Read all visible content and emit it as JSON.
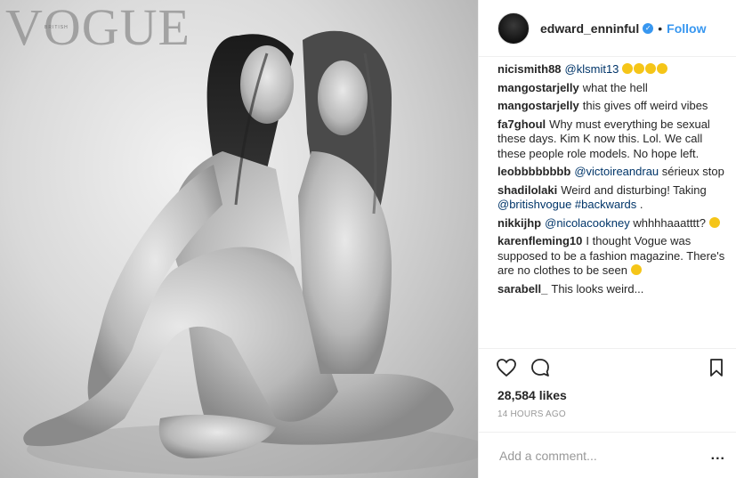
{
  "photo": {
    "masthead": "VOGUE",
    "masthead_sub": "BRITISH"
  },
  "header": {
    "username": "edward_enninful",
    "verified": true,
    "separator": "•",
    "follow_label": "Follow"
  },
  "comments": [
    {
      "user": "nicismith88",
      "parts": [
        {
          "t": "@klsmit13",
          "m": true
        },
        {
          "t": " ",
          "m": false
        }
      ],
      "emoji_count": 4
    },
    {
      "user": "mangostarjelly",
      "parts": [
        {
          "t": "what the hell",
          "m": false
        }
      ],
      "emoji_count": 0
    },
    {
      "user": "mangostarjelly",
      "parts": [
        {
          "t": "this gives off weird vibes",
          "m": false
        }
      ],
      "emoji_count": 0
    },
    {
      "user": "fa7ghoul",
      "parts": [
        {
          "t": "Why must everything be sexual these days. Kim K now this. Lol. We call these people role models. No hope left.",
          "m": false
        }
      ],
      "emoji_count": 0
    },
    {
      "user": "leobbbbbbbb",
      "parts": [
        {
          "t": "@victoireandrau",
          "m": true
        },
        {
          "t": " sérieux stop",
          "m": false
        }
      ],
      "emoji_count": 0
    },
    {
      "user": "shadilolaki",
      "parts": [
        {
          "t": "Weird and disturbing! Taking ",
          "m": false
        },
        {
          "t": "@britishvogue",
          "m": true
        },
        {
          "t": " ",
          "m": false
        },
        {
          "t": "#backwards",
          "m": true
        },
        {
          "t": " .",
          "m": false
        }
      ],
      "emoji_count": 0
    },
    {
      "user": "nikkijhp",
      "parts": [
        {
          "t": "@nicolacookney",
          "m": true
        },
        {
          "t": " whhhhaaatttt? ",
          "m": false
        }
      ],
      "emoji_count": 1
    },
    {
      "user": "karenfleming10",
      "parts": [
        {
          "t": "I thought Vogue was supposed to be a fashion magazine. There's are no clothes to be seen ",
          "m": false
        }
      ],
      "emoji_count": 1
    },
    {
      "user": "sarabell_",
      "parts": [
        {
          "t": "This looks weird...",
          "m": false
        }
      ],
      "emoji_count": 0
    }
  ],
  "actions": {
    "like_icon": "heart-icon",
    "comment_icon": "comment-icon",
    "save_icon": "bookmark-icon"
  },
  "likes_text": "28,584 likes",
  "time_ago": "14 HOURS AGO",
  "add_comment": {
    "placeholder": "Add a comment...",
    "more_label": "..."
  },
  "colors": {
    "link": "#3897f0",
    "mention": "#003569",
    "muted": "#999999",
    "border": "#efefef"
  }
}
